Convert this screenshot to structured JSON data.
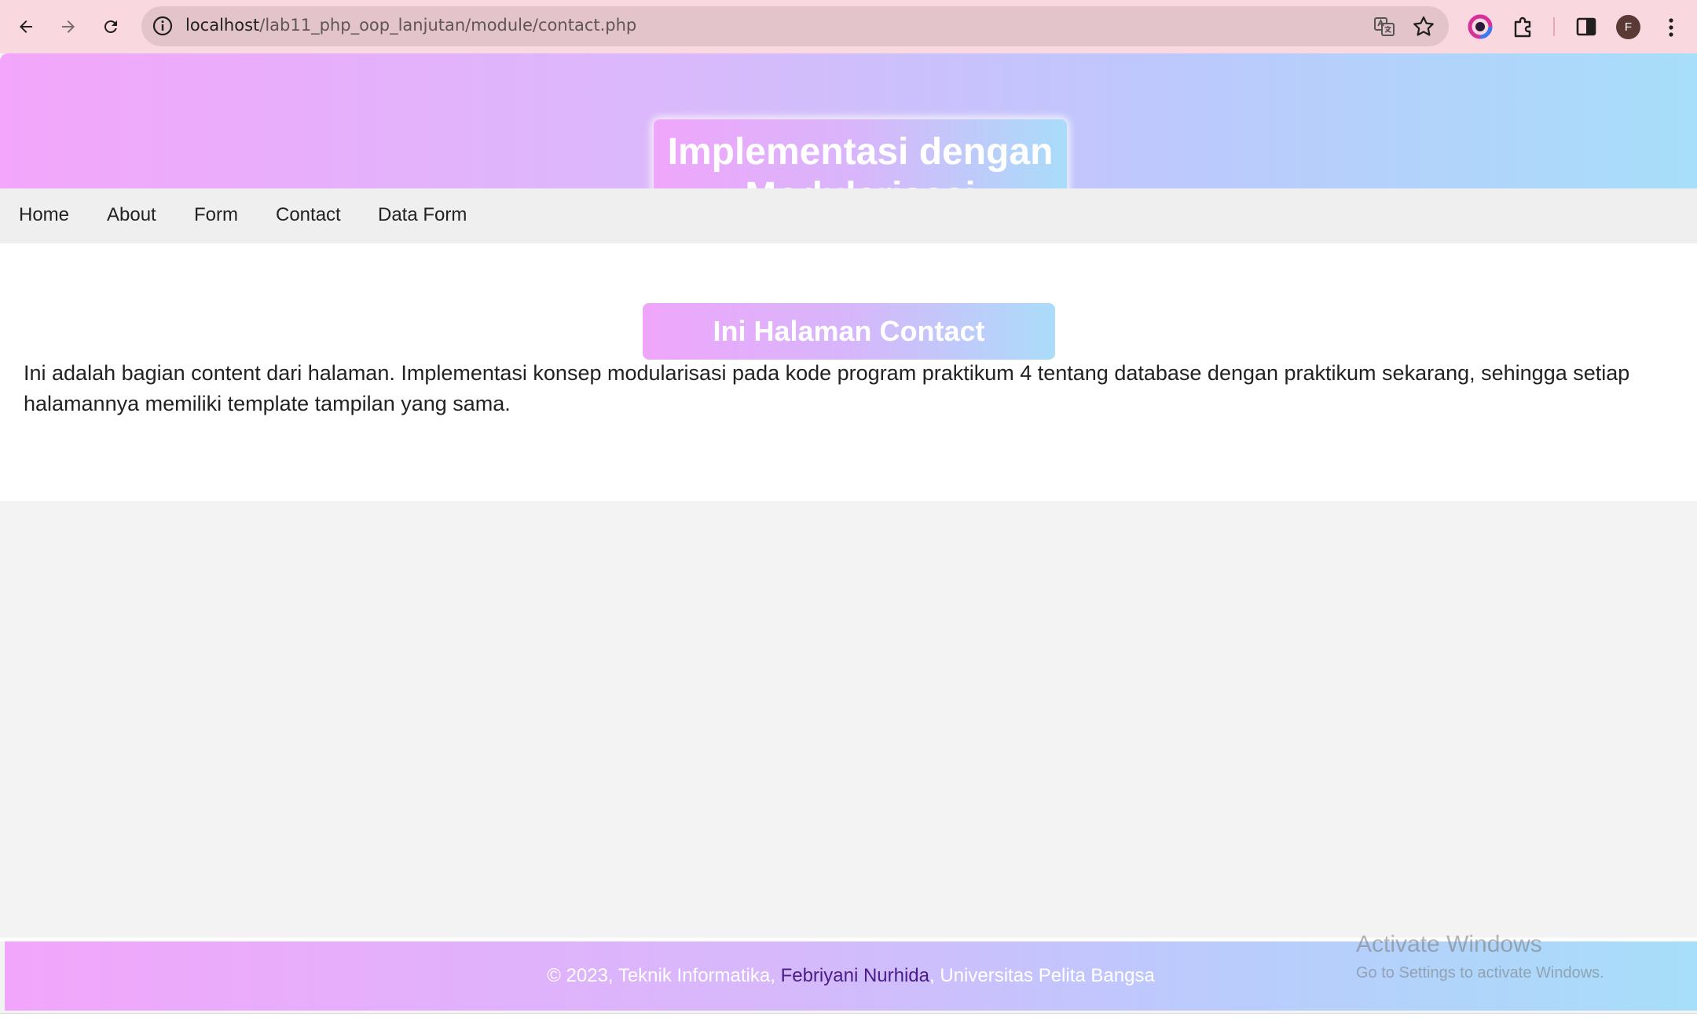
{
  "browser": {
    "url_host": "localhost",
    "url_path": "/lab11_php_oop_lanjutan/module/contact.php",
    "profile_initial": "F",
    "icons": [
      "back-arrow-icon",
      "forward-arrow-icon",
      "reload-icon",
      "site-info-icon",
      "translate-icon",
      "bookmark-star-icon",
      "color-extension-icon",
      "extensions-puzzle-icon",
      "side-panel-icon",
      "more-menu-icon"
    ]
  },
  "header": {
    "title": "Implementasi dengan Modularisasi"
  },
  "nav": {
    "items": [
      {
        "label": "Home"
      },
      {
        "label": "About"
      },
      {
        "label": "Form"
      },
      {
        "label": "Contact"
      },
      {
        "label": "Data Form"
      }
    ]
  },
  "content": {
    "title": "Ini Halaman Contact",
    "body": "Ini adalah bagian content dari halaman. Implementasi konsep modularisasi pada kode program praktikum 4 tentang database dengan praktikum sekarang, sehingga setiap halamannya memiliki template tampilan yang sama."
  },
  "footer": {
    "prefix": "© 2023, Teknik Informatika, ",
    "author": "Febriyani Nurhida",
    "suffix": ", Universitas Pelita Bangsa"
  },
  "watermark": {
    "line1": "Activate Windows",
    "line2": "Go to Settings to activate Windows."
  },
  "colors": {
    "gradient_start": "#f3a6fb",
    "gradient_end": "#a7def9",
    "author_link": "#4b1b8a"
  }
}
